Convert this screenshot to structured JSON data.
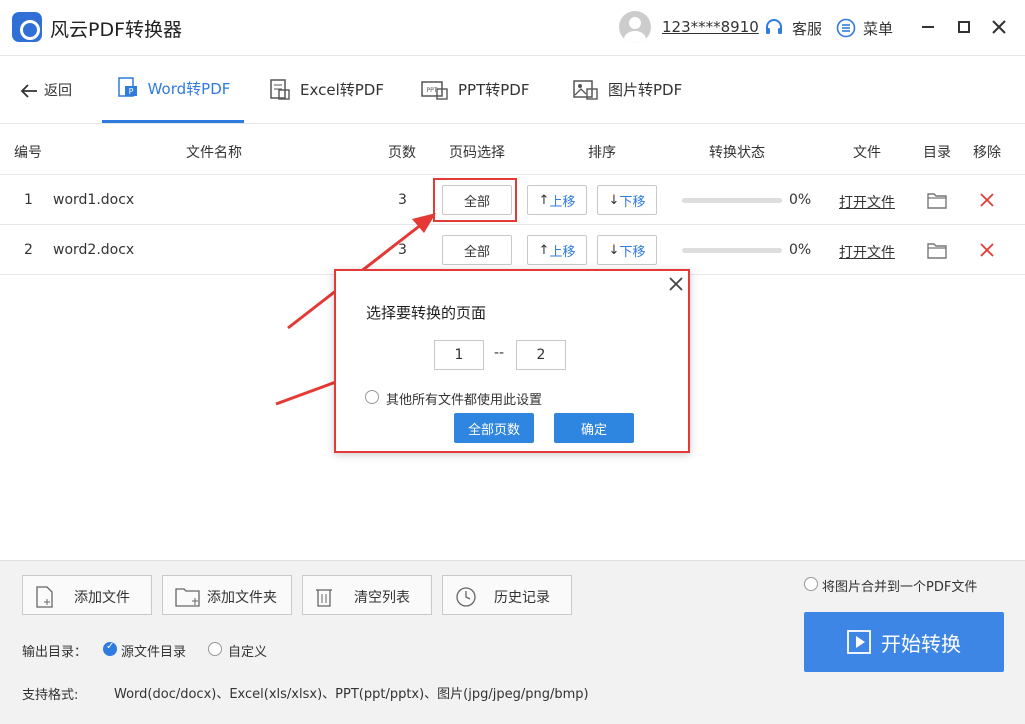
{
  "app": {
    "title": "风云PDF转换器"
  },
  "user": {
    "phone": "123****8910"
  },
  "header": {
    "service_label": "客服",
    "menu_label": "菜单"
  },
  "nav": {
    "back_label": "返回",
    "tabs": [
      {
        "label": "Word转PDF",
        "active": true
      },
      {
        "label": "Excel转PDF",
        "active": false
      },
      {
        "label": "PPT转PDF",
        "active": false
      },
      {
        "label": "图片转PDF",
        "active": false
      }
    ]
  },
  "table": {
    "headers": {
      "num": "编号",
      "name": "文件名称",
      "pages": "页数",
      "page_select": "页码选择",
      "order": "排序",
      "status": "转换状态",
      "file": "文件",
      "dir": "目录",
      "remove": "移除"
    },
    "rows": [
      {
        "num": "1",
        "name": "word1.docx",
        "pages": "3",
        "page_select": "全部",
        "up": "上移",
        "down": "下移",
        "progress": "0%",
        "open": "打开文件"
      },
      {
        "num": "2",
        "name": "word2.docx",
        "pages": "3",
        "page_select": "全部",
        "up": "上移",
        "down": "下移",
        "progress": "0%",
        "open": "打开文件"
      }
    ]
  },
  "dialog": {
    "title": "选择要转换的页面",
    "from_page": "1",
    "separator": "--",
    "to_page": "2",
    "apply_all_label": "其他所有文件都使用此设置",
    "all_pages_button": "全部页数",
    "confirm_button": "确定"
  },
  "bottom": {
    "add_file": "添加文件",
    "add_folder": "添加文件夹",
    "clear_list": "清空列表",
    "history": "历史记录",
    "merge_label": "将图片合并到一个PDF文件",
    "start_button": "开始转换",
    "output_label": "输出目录：",
    "output_option_source": "源文件目录",
    "output_option_custom": "自定义",
    "formats_label": "支持格式:",
    "formats_value": "Word(doc/docx)、Excel(xls/xlsx)、PPT(ppt/pptx)、图片(jpg/jpeg/png/bmp)"
  },
  "colors": {
    "accent": "#2f7be0",
    "annotation": "#e53935",
    "start_button": "#3e86e6"
  }
}
